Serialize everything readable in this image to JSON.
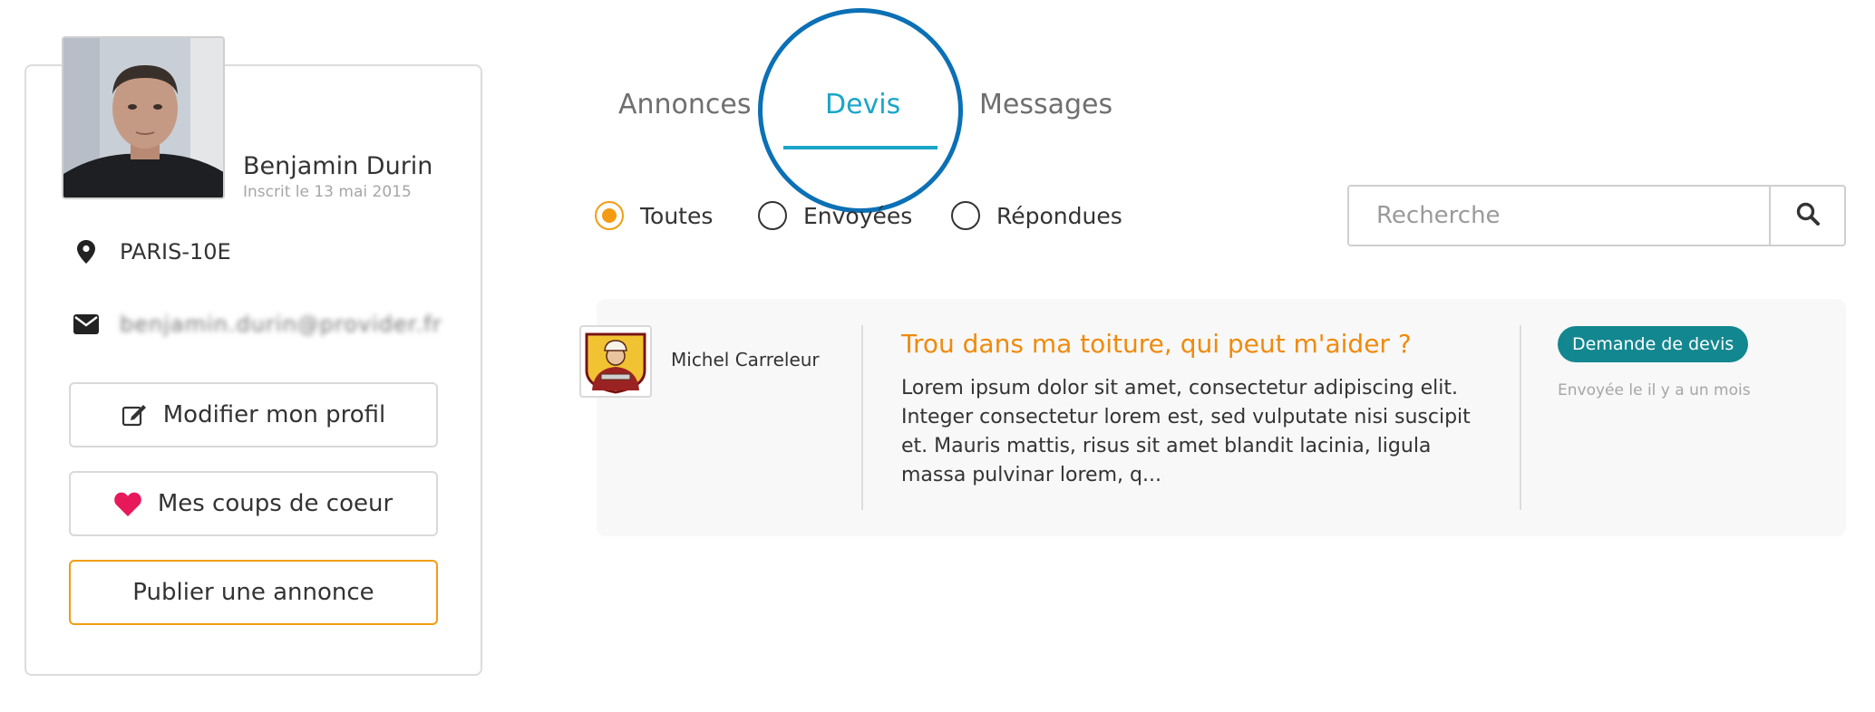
{
  "profile": {
    "name": "Benjamin Durin",
    "member_since": "Inscrit le 13 mai 2015",
    "location": "PARIS-10E",
    "email": "benjamin.durin@provider.fr",
    "buttons": {
      "edit_profile": "Modifier mon profil",
      "favorites": "Mes coups de coeur",
      "publish_ad": "Publier une annonce"
    },
    "icons": {
      "location": "map-pin-icon",
      "email": "envelope-icon",
      "edit": "edit-icon",
      "favorites": "heart-icon"
    }
  },
  "tabs": [
    {
      "label": "Annonces",
      "active": false
    },
    {
      "label": "Devis",
      "active": true
    },
    {
      "label": "Messages",
      "active": false
    }
  ],
  "filters": {
    "options": [
      {
        "label": "Toutes",
        "checked": true
      },
      {
        "label": "Envoyées",
        "checked": false
      },
      {
        "label": "Répondues",
        "checked": false
      }
    ]
  },
  "search": {
    "placeholder": "Recherche",
    "value": "",
    "icon": "search-icon"
  },
  "results": [
    {
      "pro_name": "Michel Carreleur",
      "title": "Trou dans ma toiture, qui peut m'aider ?",
      "excerpt": "Lorem ipsum dolor sit amet, consectetur adipiscing elit. Integer consectetur lorem est, sed vulputate nisi suscipit et. Mauris mattis, risus sit amet blandit lacinia, ligula massa pulvinar lorem, q...",
      "badge": "Demande de devis",
      "sent": "Envoyée le il y a un mois"
    }
  ],
  "colors": {
    "accent_orange": "#f39c12",
    "title_orange": "#f08a0c",
    "tab_active": "#1aa6c8",
    "badge_teal": "#13878f",
    "highlight_circle": "#0b70b5",
    "heart": "#e8195b"
  }
}
